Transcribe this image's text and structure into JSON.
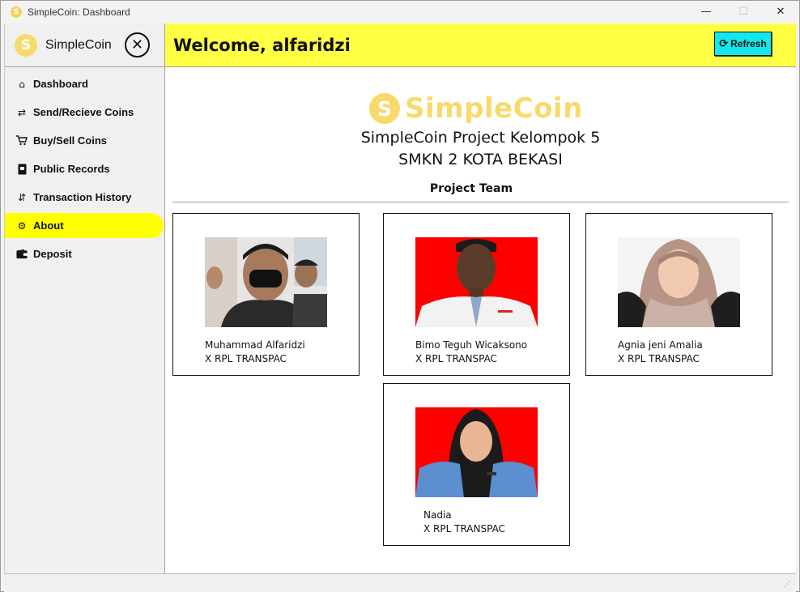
{
  "window": {
    "title": "SimpleCoin: Dashboard",
    "minimize_glyph": "—",
    "maximize_glyph": "☐",
    "close_glyph": "✕"
  },
  "sidebar": {
    "brand_name": "SimpleCoin",
    "brand_icon_glyph": "S",
    "close_glyph": "✕",
    "items": [
      {
        "label": "Dashboard",
        "icon": "home-icon",
        "glyph": "⌂"
      },
      {
        "label": "Send/Recieve Coins",
        "icon": "transfer-icon",
        "glyph": "⇄"
      },
      {
        "label": "Buy/Sell Coins",
        "icon": "cart-icon",
        "glyph": "🛒"
      },
      {
        "label": "Public Records",
        "icon": "book-icon",
        "glyph": "▮"
      },
      {
        "label": "Transaction History",
        "icon": "history-icon",
        "glyph": "⇵"
      },
      {
        "label": "About",
        "icon": "gear-icon",
        "glyph": "⚙",
        "active": true
      },
      {
        "label": "Deposit",
        "icon": "wallet-icon",
        "glyph": "▬"
      }
    ]
  },
  "header": {
    "welcome": "Welcome, alfaridzi",
    "refresh_label": "Refresh",
    "refresh_glyph": "⟳",
    "bg_color": "#ffff44",
    "button_color": "#12e7ec"
  },
  "about": {
    "logo_text": "SimpleCoin",
    "logo_glyph": "S",
    "line1": "SimpleCoin Project Kelompok 5",
    "line2": "SMKN 2 KOTA BEKASI",
    "team_title": "Project Team",
    "members": [
      {
        "name": "Muhammad Alfaridzi",
        "class": "X RPL TRANSPAC",
        "photo_bg": "#e8e8e8"
      },
      {
        "name": "Bimo Teguh Wicaksono",
        "class": "X RPL TRANSPAC",
        "photo_bg": "#ff0000"
      },
      {
        "name": "Agnia jeni Amalia",
        "class": "X RPL TRANSPAC",
        "photo_bg": "#f4f4f4"
      },
      {
        "name": "Nadia",
        "class": "X RPL TRANSPAC",
        "photo_bg": "#ff0000"
      }
    ]
  },
  "colors": {
    "accent_yellow": "#ffff00",
    "coin_gold": "#f8da6b"
  }
}
